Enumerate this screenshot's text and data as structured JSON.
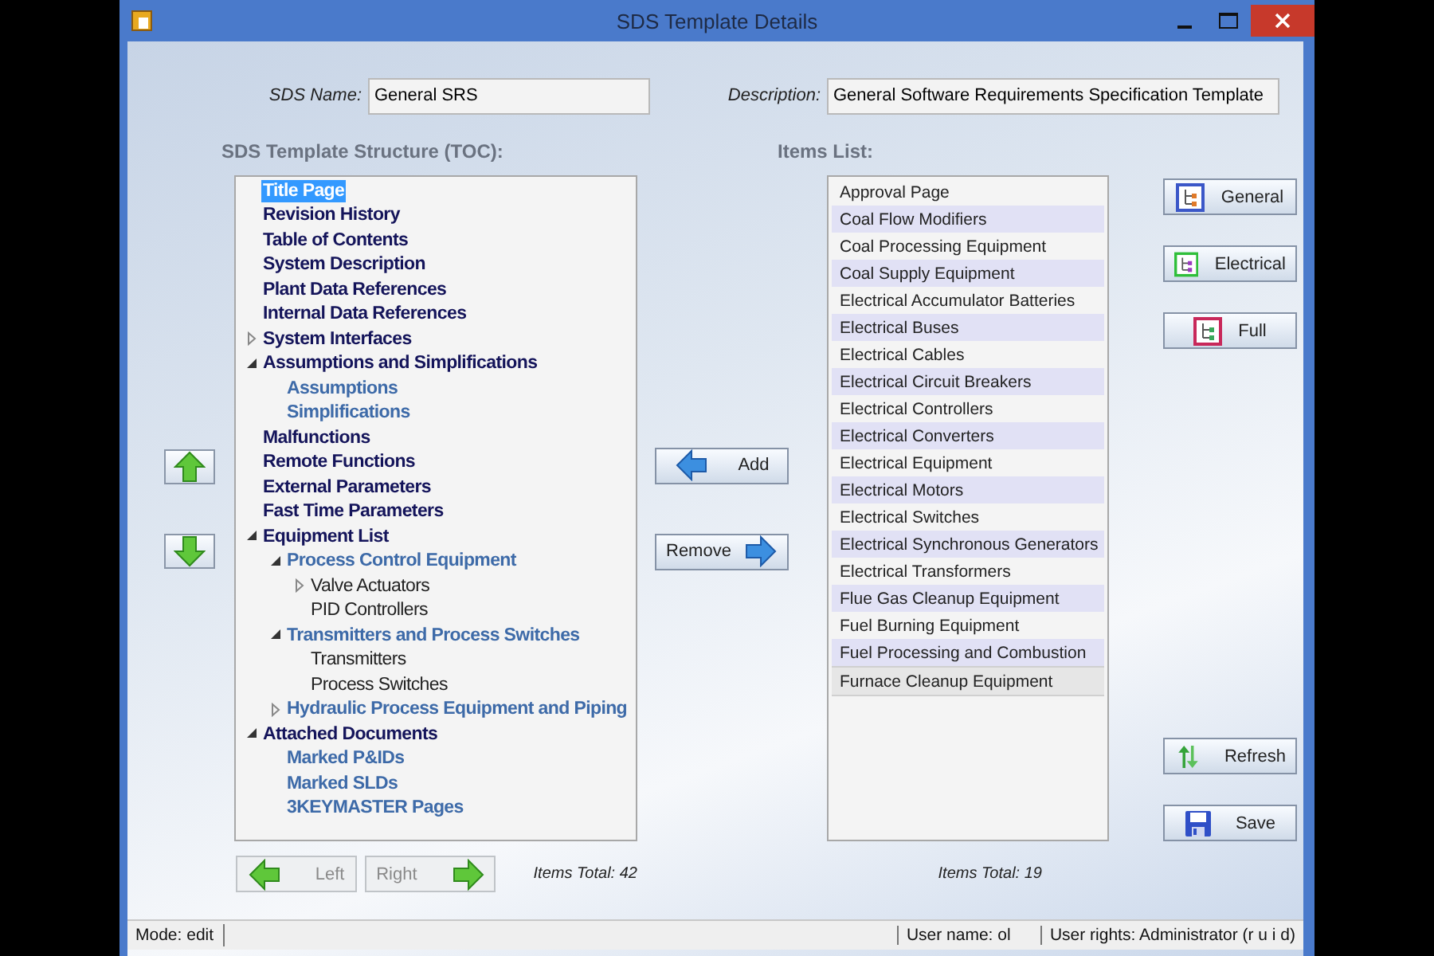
{
  "window": {
    "title": "SDS Template Details"
  },
  "fields": [
    {
      "label": "SDS Name:",
      "value": "General SRS"
    },
    {
      "label": "Description:",
      "value": "General Software Requirements Specification Template"
    }
  ],
  "toc": {
    "title": "SDS Template Structure (TOC):",
    "total": "Items Total: 42",
    "items": [
      {
        "label": "Title Page",
        "selected": true
      },
      {
        "label": "Revision History",
        "selected": false
      },
      {
        "label": "Table of Contents",
        "selected": false
      },
      {
        "label": "System Description",
        "selected": false
      },
      {
        "label": "Plant Data References",
        "selected": false
      },
      {
        "label": "Internal Data References",
        "selected": false
      },
      {
        "label": "System Interfaces",
        "selected": false,
        "expanded": false
      },
      {
        "label": "Assumptions and Simplifications",
        "selected": false,
        "expanded": true,
        "children": [
          {
            "label": "Assumptions",
            "selected": false
          },
          {
            "label": "Simplifications",
            "selected": false
          }
        ]
      },
      {
        "label": "Malfunctions",
        "selected": false
      },
      {
        "label": "Remote Functions",
        "selected": false
      },
      {
        "label": "External Parameters",
        "selected": false
      },
      {
        "label": "Fast Time Parameters",
        "selected": false
      },
      {
        "label": "Equipment List",
        "selected": false,
        "expanded": true,
        "children": [
          {
            "label": "Process Control Equipment",
            "selected": false,
            "expanded": true,
            "children": [
              {
                "label": "Valve Actuators",
                "selected": false,
                "expanded": false
              },
              {
                "label": "PID Controllers",
                "selected": false
              }
            ]
          },
          {
            "label": "Transmitters and Process Switches",
            "selected": false,
            "expanded": true,
            "children": [
              {
                "label": "Transmitters",
                "selected": false
              },
              {
                "label": "Process Switches",
                "selected": false
              }
            ]
          },
          {
            "label": "Hydraulic Process Equipment and Piping",
            "selected": false,
            "expanded": false
          }
        ]
      },
      {
        "label": "Attached Documents",
        "selected": false,
        "expanded": true,
        "children": [
          {
            "label": "Marked P&IDs",
            "selected": false
          },
          {
            "label": "Marked SLDs",
            "selected": false
          },
          {
            "label": "3KEYMASTER Pages",
            "selected": false
          }
        ]
      }
    ]
  },
  "move_buttons": [
    {
      "kind": "left",
      "label": "Left",
      "disabled": true
    },
    {
      "kind": "right",
      "label": "Right",
      "disabled": true
    }
  ],
  "transfer_buttons": [
    {
      "kind": "add",
      "label": "Add",
      "disabled": false
    },
    {
      "kind": "remove",
      "label": "Remove",
      "disabled": false
    }
  ],
  "items_list": {
    "title": "Items List:",
    "total": "Items Total: 19",
    "items": [
      {
        "label": "Approval Page",
        "selected": false
      },
      {
        "label": "Coal Flow Modifiers",
        "selected": false
      },
      {
        "label": "Coal Processing Equipment",
        "selected": false
      },
      {
        "label": "Coal Supply Equipment",
        "selected": false
      },
      {
        "label": "Electrical Accumulator Batteries",
        "selected": false
      },
      {
        "label": "Electrical Buses",
        "selected": false
      },
      {
        "label": "Electrical Cables",
        "selected": false
      },
      {
        "label": "Electrical Circuit Breakers",
        "selected": false
      },
      {
        "label": "Electrical Controllers",
        "selected": false
      },
      {
        "label": "Electrical Converters",
        "selected": false
      },
      {
        "label": "Electrical Equipment",
        "selected": false
      },
      {
        "label": "Electrical Motors",
        "selected": false
      },
      {
        "label": "Electrical Switches",
        "selected": false
      },
      {
        "label": "Electrical Synchronous Generators",
        "selected": false
      },
      {
        "label": "Electrical Transformers",
        "selected": false
      },
      {
        "label": "Flue Gas Cleanup Equipment",
        "selected": false
      },
      {
        "label": "Fuel Burning Equipment",
        "selected": false
      },
      {
        "label": "Fuel Processing and Combustion",
        "selected": false
      },
      {
        "label": "Furnace Cleanup Equipment",
        "selected": true
      }
    ]
  },
  "template_buttons": [
    {
      "kind": "general",
      "label": "General"
    },
    {
      "kind": "electrical",
      "label": "Electrical"
    },
    {
      "kind": "full",
      "label": "Full"
    }
  ],
  "action_buttons": [
    {
      "kind": "refresh",
      "label": "Refresh"
    },
    {
      "kind": "save",
      "label": "Save"
    }
  ],
  "status_bar": {
    "mode": "Mode: edit",
    "user_name": "User name:  ol",
    "user_rights": "User rights:  Administrator (r u i d)"
  }
}
